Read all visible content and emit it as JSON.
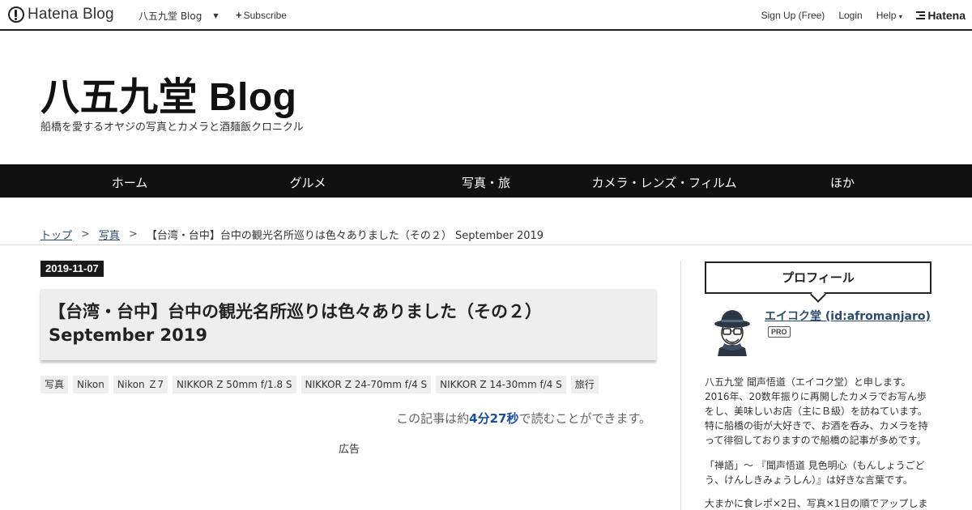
{
  "topbar": {
    "logo_text": "Hatena Blog",
    "blog_name": "八五九堂 Blog",
    "subscribe_label": "Subscribe",
    "signup_label": "Sign Up (Free)",
    "login_label": "Login",
    "help_label": "Help",
    "hatena_label": "Hatena"
  },
  "header": {
    "title": "八五九堂 Blog",
    "description": "船橋を愛するオヤジの写真とカメラと酒麺飯クロニクル"
  },
  "nav": {
    "items": [
      "ホーム",
      "グルメ",
      "写真・旅",
      "カメラ・レンズ・フィルム",
      "ほか"
    ]
  },
  "breadcrumb": {
    "top": "トップ",
    "category": "写真",
    "current": "【台湾・台中】台中の観光名所巡りは色々ありました（その２） September 2019"
  },
  "entry": {
    "date": "2019-11-07",
    "title_line1": "【台湾・台中】台中の観光名所巡りは色々ありました（その２）",
    "title_line2": "September 2019",
    "categories": [
      "写真",
      "Nikon",
      "Nikon Ｚ7",
      "NIKKOR Z 50mm f/1.8 S",
      "NIKKOR Z 24-70mm f/4 S",
      "NIKKOR Z 14-30mm f/4 S",
      "旅行"
    ],
    "readtime_prefix": "この記事は約",
    "readtime_value": "4分27秒",
    "readtime_suffix": "で読むことができます。",
    "ad_label": "広告"
  },
  "sidebar": {
    "profile_heading": "プロフィール",
    "profile_name": "エイコク堂 (id:afromanjaro)",
    "pro_badge": "PRO",
    "para1_lines": [
      "八五九堂 聞声悟道（エイコク堂）と申します。",
      "2016年、20数年振りに再開したカメラでお写ん歩",
      "をし、美味しいお店（主にＢ級）を訪ねています。",
      "特に船橋の街が大好きで、お酒を呑み、カメラを持",
      "って徘徊しておりますので船橋の記事が多めです。"
    ],
    "para2_lines": [
      "「禅語」～ 『聞声悟道 見色明心（もんしょうごど",
      "う、けんしきみょうしん）』は好きな言葉です。"
    ],
    "para3_lines": [
      "大まかに食レポ×2日、写真×1日の順でアップしま"
    ]
  }
}
